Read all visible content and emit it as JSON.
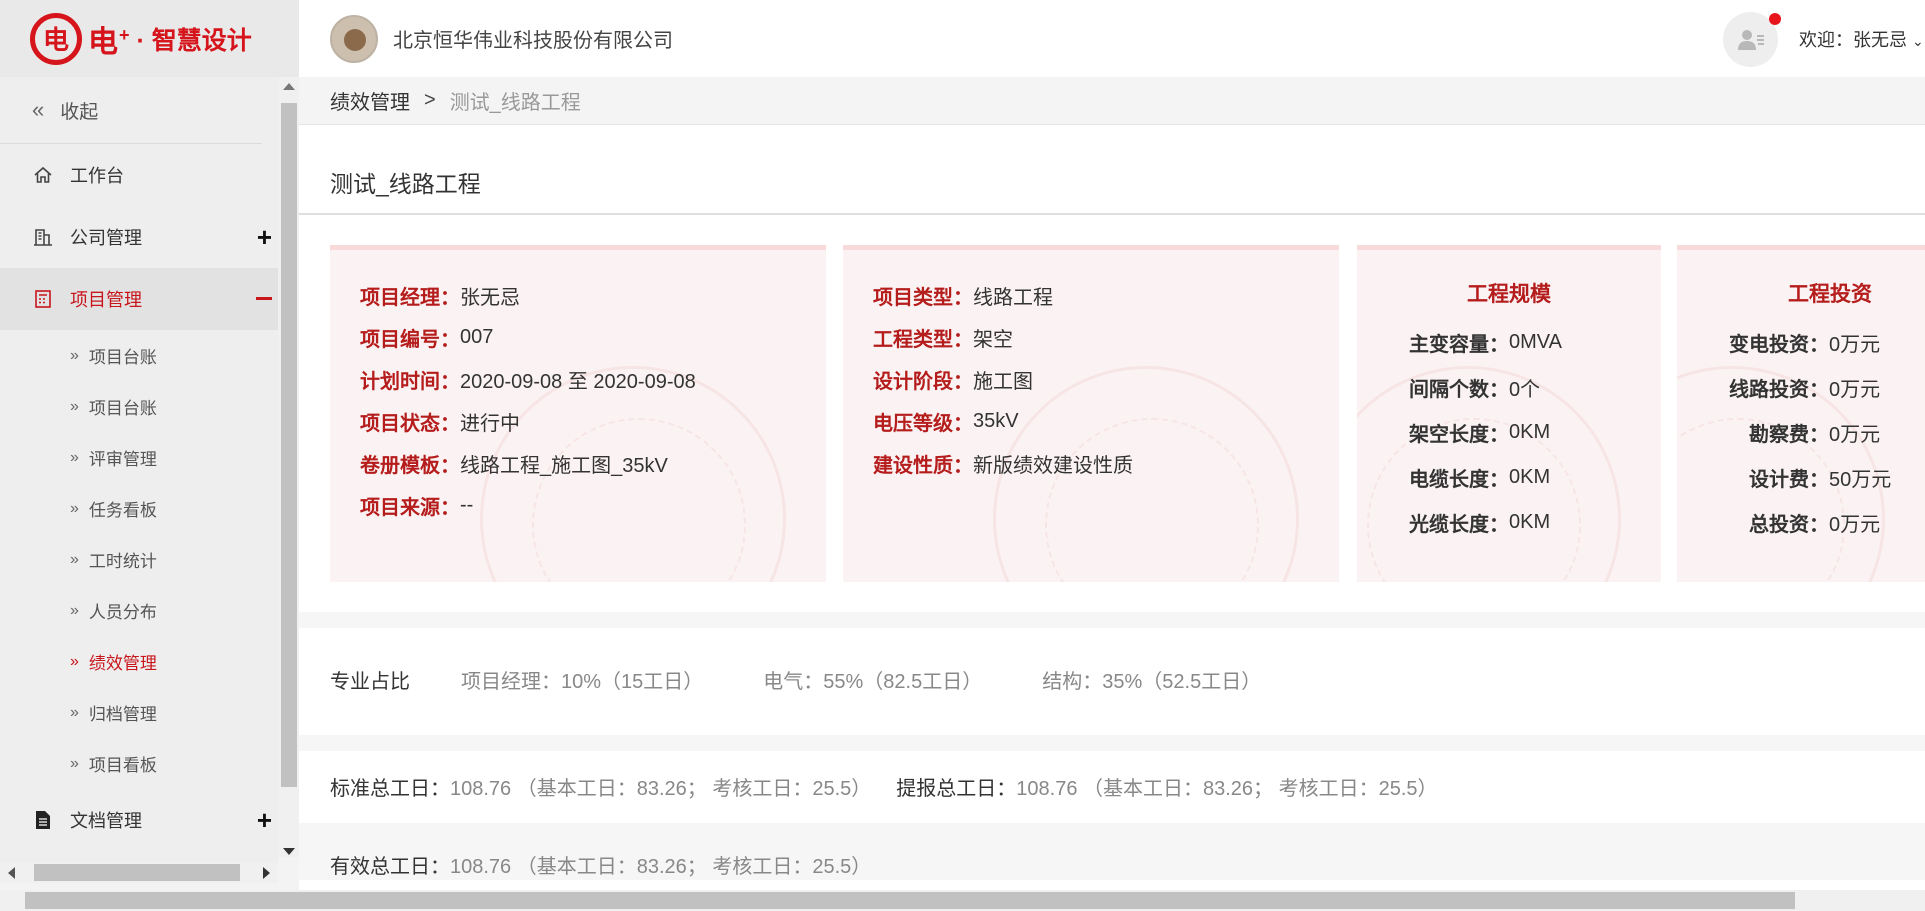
{
  "brand": {
    "logo_char": "电",
    "name": "电",
    "plus": "+",
    "sub": "· 智慧设计"
  },
  "header": {
    "company": "北京恒华伟业科技股份有限公司",
    "welcome": "欢迎：张无忌"
  },
  "sidebar": {
    "collapse_label": "收起",
    "items": [
      {
        "label": "工作台",
        "icon": "home-icon"
      },
      {
        "label": "公司管理",
        "icon": "building-icon",
        "expand": "+"
      },
      {
        "label": "项目管理",
        "icon": "calculator-icon",
        "expand": "−",
        "active": true
      },
      {
        "label": "文档管理",
        "icon": "document-icon",
        "expand": "+"
      }
    ],
    "sub_items": [
      {
        "label": "项目台账"
      },
      {
        "label": "项目台账"
      },
      {
        "label": "评审管理"
      },
      {
        "label": "任务看板"
      },
      {
        "label": "工时统计"
      },
      {
        "label": "人员分布"
      },
      {
        "label": "绩效管理",
        "active": true
      },
      {
        "label": "归档管理"
      },
      {
        "label": "项目看板"
      }
    ]
  },
  "breadcrumb": {
    "parent": "绩效管理",
    "separator": ">",
    "current": "测试_线路工程"
  },
  "page": {
    "title": "测试_线路工程"
  },
  "card1": [
    {
      "k": "项目经理：",
      "v": "张无忌"
    },
    {
      "k": "项目编号：",
      "v": "007"
    },
    {
      "k": "计划时间：",
      "v": "2020-09-08 至 2020-09-08"
    },
    {
      "k": "项目状态：",
      "v": "进行中"
    },
    {
      "k": "卷册模板：",
      "v": "线路工程_施工图_35kV"
    },
    {
      "k": "项目来源：",
      "v": "--"
    }
  ],
  "card2": [
    {
      "k": "项目类型：",
      "v": "线路工程"
    },
    {
      "k": "工程类型：",
      "v": "架空"
    },
    {
      "k": "设计阶段：",
      "v": "施工图"
    },
    {
      "k": "电压等级：",
      "v": "35kV"
    },
    {
      "k": "建设性质：",
      "v": "新版绩效建设性质"
    }
  ],
  "card3": {
    "title": "工程规模",
    "rows": [
      {
        "k": "主变容量：",
        "v": "0MVA"
      },
      {
        "k": "间隔个数：",
        "v": "0个"
      },
      {
        "k": "架空长度：",
        "v": "0KM"
      },
      {
        "k": "电缆长度：",
        "v": "0KM"
      },
      {
        "k": "光缆长度：",
        "v": "0KM"
      }
    ]
  },
  "card4": {
    "title": "工程投资",
    "rows": [
      {
        "k": "变电投资：",
        "v": "0万元"
      },
      {
        "k": "线路投资：",
        "v": "0万元"
      },
      {
        "k": "勘察费：",
        "v": "0万元"
      },
      {
        "k": "设计费：",
        "v": "50万元"
      },
      {
        "k": "总投资：",
        "v": "0万元"
      }
    ]
  },
  "specialty": {
    "label": "专业占比",
    "items": [
      "项目经理：10%（15工日）",
      "电气：55%（82.5工日）",
      "结构：35%（52.5工日）"
    ]
  },
  "totals": {
    "standard_k": "标准总工日：",
    "standard_v": "108.76 （基本工日：83.26； 考核工日：25.5）",
    "reported_k": "提报总工日：",
    "reported_v": "108.76 （基本工日：83.26； 考核工日：25.5）",
    "effective_k": "有效总工日：",
    "effective_v": "108.76 （基本工日：83.26； 考核工日：25.5）"
  },
  "colors": {
    "accent": "#c8161d",
    "label_red": "#b51c1c",
    "card_bg": "#fbf3f3"
  }
}
